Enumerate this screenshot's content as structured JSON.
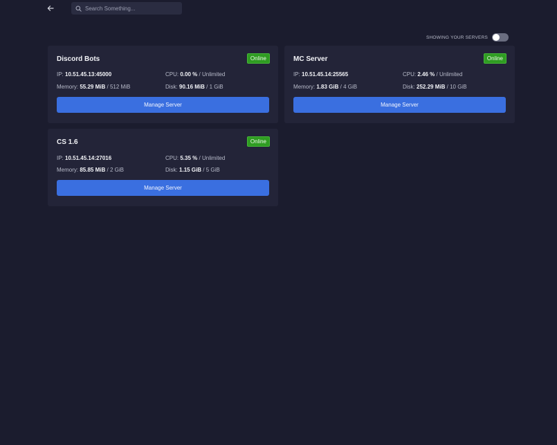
{
  "search": {
    "placeholder": "Search Something..."
  },
  "toggle": {
    "label": "SHOWING YOUR SERVERS"
  },
  "servers": [
    {
      "name": "Discord Bots",
      "status": "Online",
      "ip_label": "IP:",
      "ip": "10.51.45.13:45000",
      "cpu_label": "CPU:",
      "cpu": "0.00 %",
      "cpu_limit": "Unlimited",
      "mem_label": "Memory:",
      "mem": "55.29 MiB",
      "mem_limit": "512 MiB",
      "disk_label": "Disk:",
      "disk": "90.16 MiB",
      "disk_limit": "1 GiB",
      "button": "Manage Server"
    },
    {
      "name": "MC Server",
      "status": "Online",
      "ip_label": "IP:",
      "ip": "10.51.45.14:25565",
      "cpu_label": "CPU:",
      "cpu": "2.46 %",
      "cpu_limit": "Unlimited",
      "mem_label": "Memory:",
      "mem": "1.83 GiB",
      "mem_limit": "4 GiB",
      "disk_label": "Disk:",
      "disk": "252.29 MiB",
      "disk_limit": "10 GiB",
      "button": "Manage Server"
    },
    {
      "name": "CS 1.6",
      "status": "Online",
      "ip_label": "IP:",
      "ip": "10.51.45.14:27016",
      "cpu_label": "CPU:",
      "cpu": "5.35 %",
      "cpu_limit": "Unlimited",
      "mem_label": "Memory:",
      "mem": "85.85 MiB",
      "mem_limit": "2 GiB",
      "disk_label": "Disk:",
      "disk": "1.15 GiB",
      "disk_limit": "5 GiB",
      "button": "Manage Server"
    }
  ],
  "separator": "/",
  "colors": {
    "background": "#1b1c2e",
    "card": "#232438",
    "online": "#2f9c22",
    "accent": "#3a6fe0"
  }
}
